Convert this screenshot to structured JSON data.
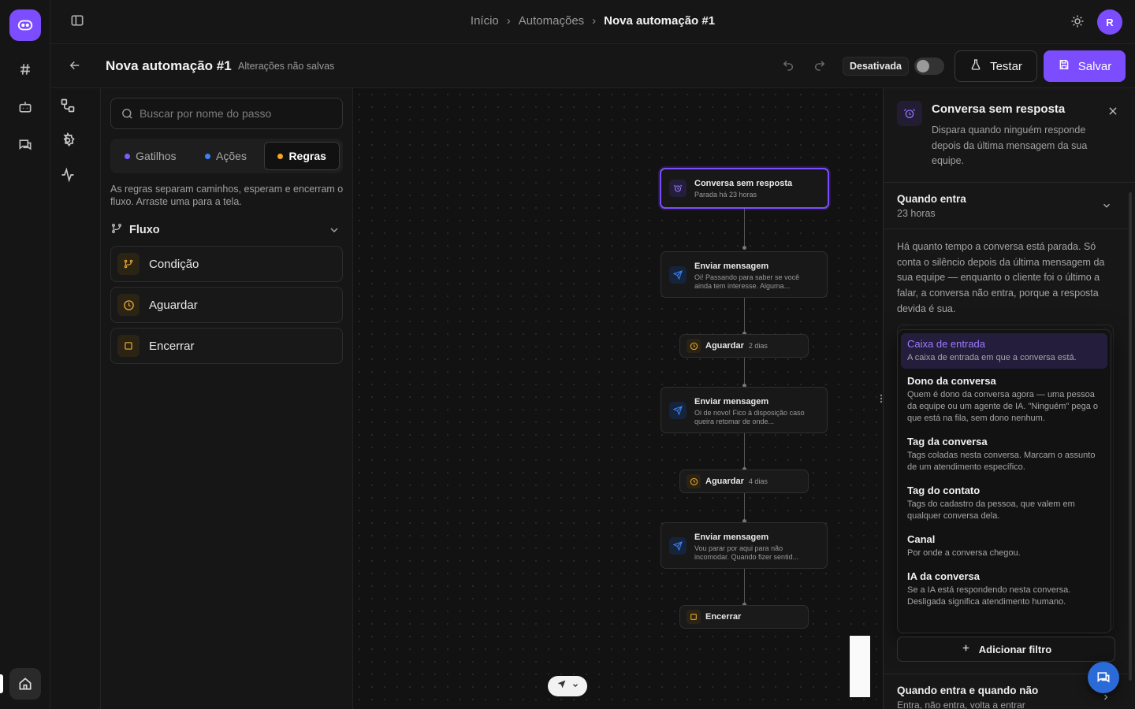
{
  "breadcrumb": [
    "Início",
    "Automações",
    "Nova automação #1"
  ],
  "user": {
    "avatar_initial": "R"
  },
  "header": {
    "title": "Nova automação #1",
    "unsaved": "Alterações não salvas",
    "status": "Desativada",
    "test_label": "Testar",
    "save_label": "Salvar"
  },
  "panel": {
    "search_placeholder": "Buscar por nome do passo",
    "tabs": [
      {
        "label": "Gatilhos",
        "dot": "#7c5cff"
      },
      {
        "label": "Ações",
        "dot": "#3b82f6"
      },
      {
        "label": "Regras",
        "dot": "#f5a524"
      }
    ],
    "help": "As regras separam caminhos, esperam e encerram o fluxo. Arraste uma para a tela.",
    "section": "Fluxo",
    "items": [
      "Condição",
      "Aguardar",
      "Encerrar"
    ]
  },
  "canvas": {
    "trigger": {
      "title": "Conversa sem resposta",
      "sub": "Parada há 23 horas"
    },
    "msg1": {
      "title": "Enviar mensagem",
      "sub": "Oi! Passando para saber se você ainda tem interesse. Alguma..."
    },
    "wait1": {
      "title": "Aguardar",
      "sub": "2 dias"
    },
    "msg2": {
      "title": "Enviar mensagem",
      "sub": "Oi de novo! Fico à disposição caso queira retomar de onde..."
    },
    "wait2": {
      "title": "Aguardar",
      "sub": "4 dias"
    },
    "msg3": {
      "title": "Enviar mensagem",
      "sub": "Vou parar por aqui para não incomodar. Quando fizer sentid..."
    },
    "end": {
      "title": "Encerrar"
    }
  },
  "inspector": {
    "title": "Conversa sem resposta",
    "desc": "Dispara quando ninguém responde depois da última mensagem da sua equipe.",
    "when_title": "Quando entra",
    "when_sub": "23 horas",
    "when_text": "Há quanto tempo a conversa está parada. Só conta o silêncio depois da última mensagem da sua equipe — enquanto o cliente foi o último a falar, a conversa não entra, porque a resposta devida é sua.",
    "options": [
      {
        "label": "Caixa de entrada",
        "desc": "A caixa de entrada em que a conversa está."
      },
      {
        "label": "Dono da conversa",
        "desc": "Quem é dono da conversa agora — uma pessoa da equipe ou um agente de IA. \"Ninguém\" pega o que está na fila, sem dono nenhum."
      },
      {
        "label": "Tag da conversa",
        "desc": "Tags coladas nesta conversa. Marcam o assunto de um atendimento específico."
      },
      {
        "label": "Tag do contato",
        "desc": "Tags do cadastro da pessoa, que valem em qualquer conversa dela."
      },
      {
        "label": "Canal",
        "desc": "Por onde a conversa chegou."
      },
      {
        "label": "IA da conversa",
        "desc": "Se a IA está respondendo nesta conversa. Desligada significa atendimento humano."
      }
    ],
    "add_filter": "Adicionar filtro",
    "bottom_title": "Quando entra e quando não",
    "bottom_sub": "Entra, não entra, volta a entrar"
  },
  "colors": {
    "accent": "#7c4dff",
    "rule": "#f5a524",
    "action": "#3b82f6",
    "fab": "#2b6bd8"
  },
  "icons": [
    "logo-icon",
    "hash-icon",
    "bot-icon",
    "messages-icon",
    "home-icon",
    "sidebar-toggle-icon",
    "sun-icon",
    "back-arrow-icon",
    "undo-icon",
    "redo-icon",
    "flask-icon",
    "save-icon",
    "workflow-icon",
    "settings-icon",
    "activity-icon",
    "search-icon",
    "branch-icon",
    "clock-icon",
    "square-icon",
    "send-icon",
    "alarm-icon",
    "close-icon",
    "chevron-down-icon",
    "plus-icon",
    "chat-icon",
    "navigation-icon"
  ]
}
